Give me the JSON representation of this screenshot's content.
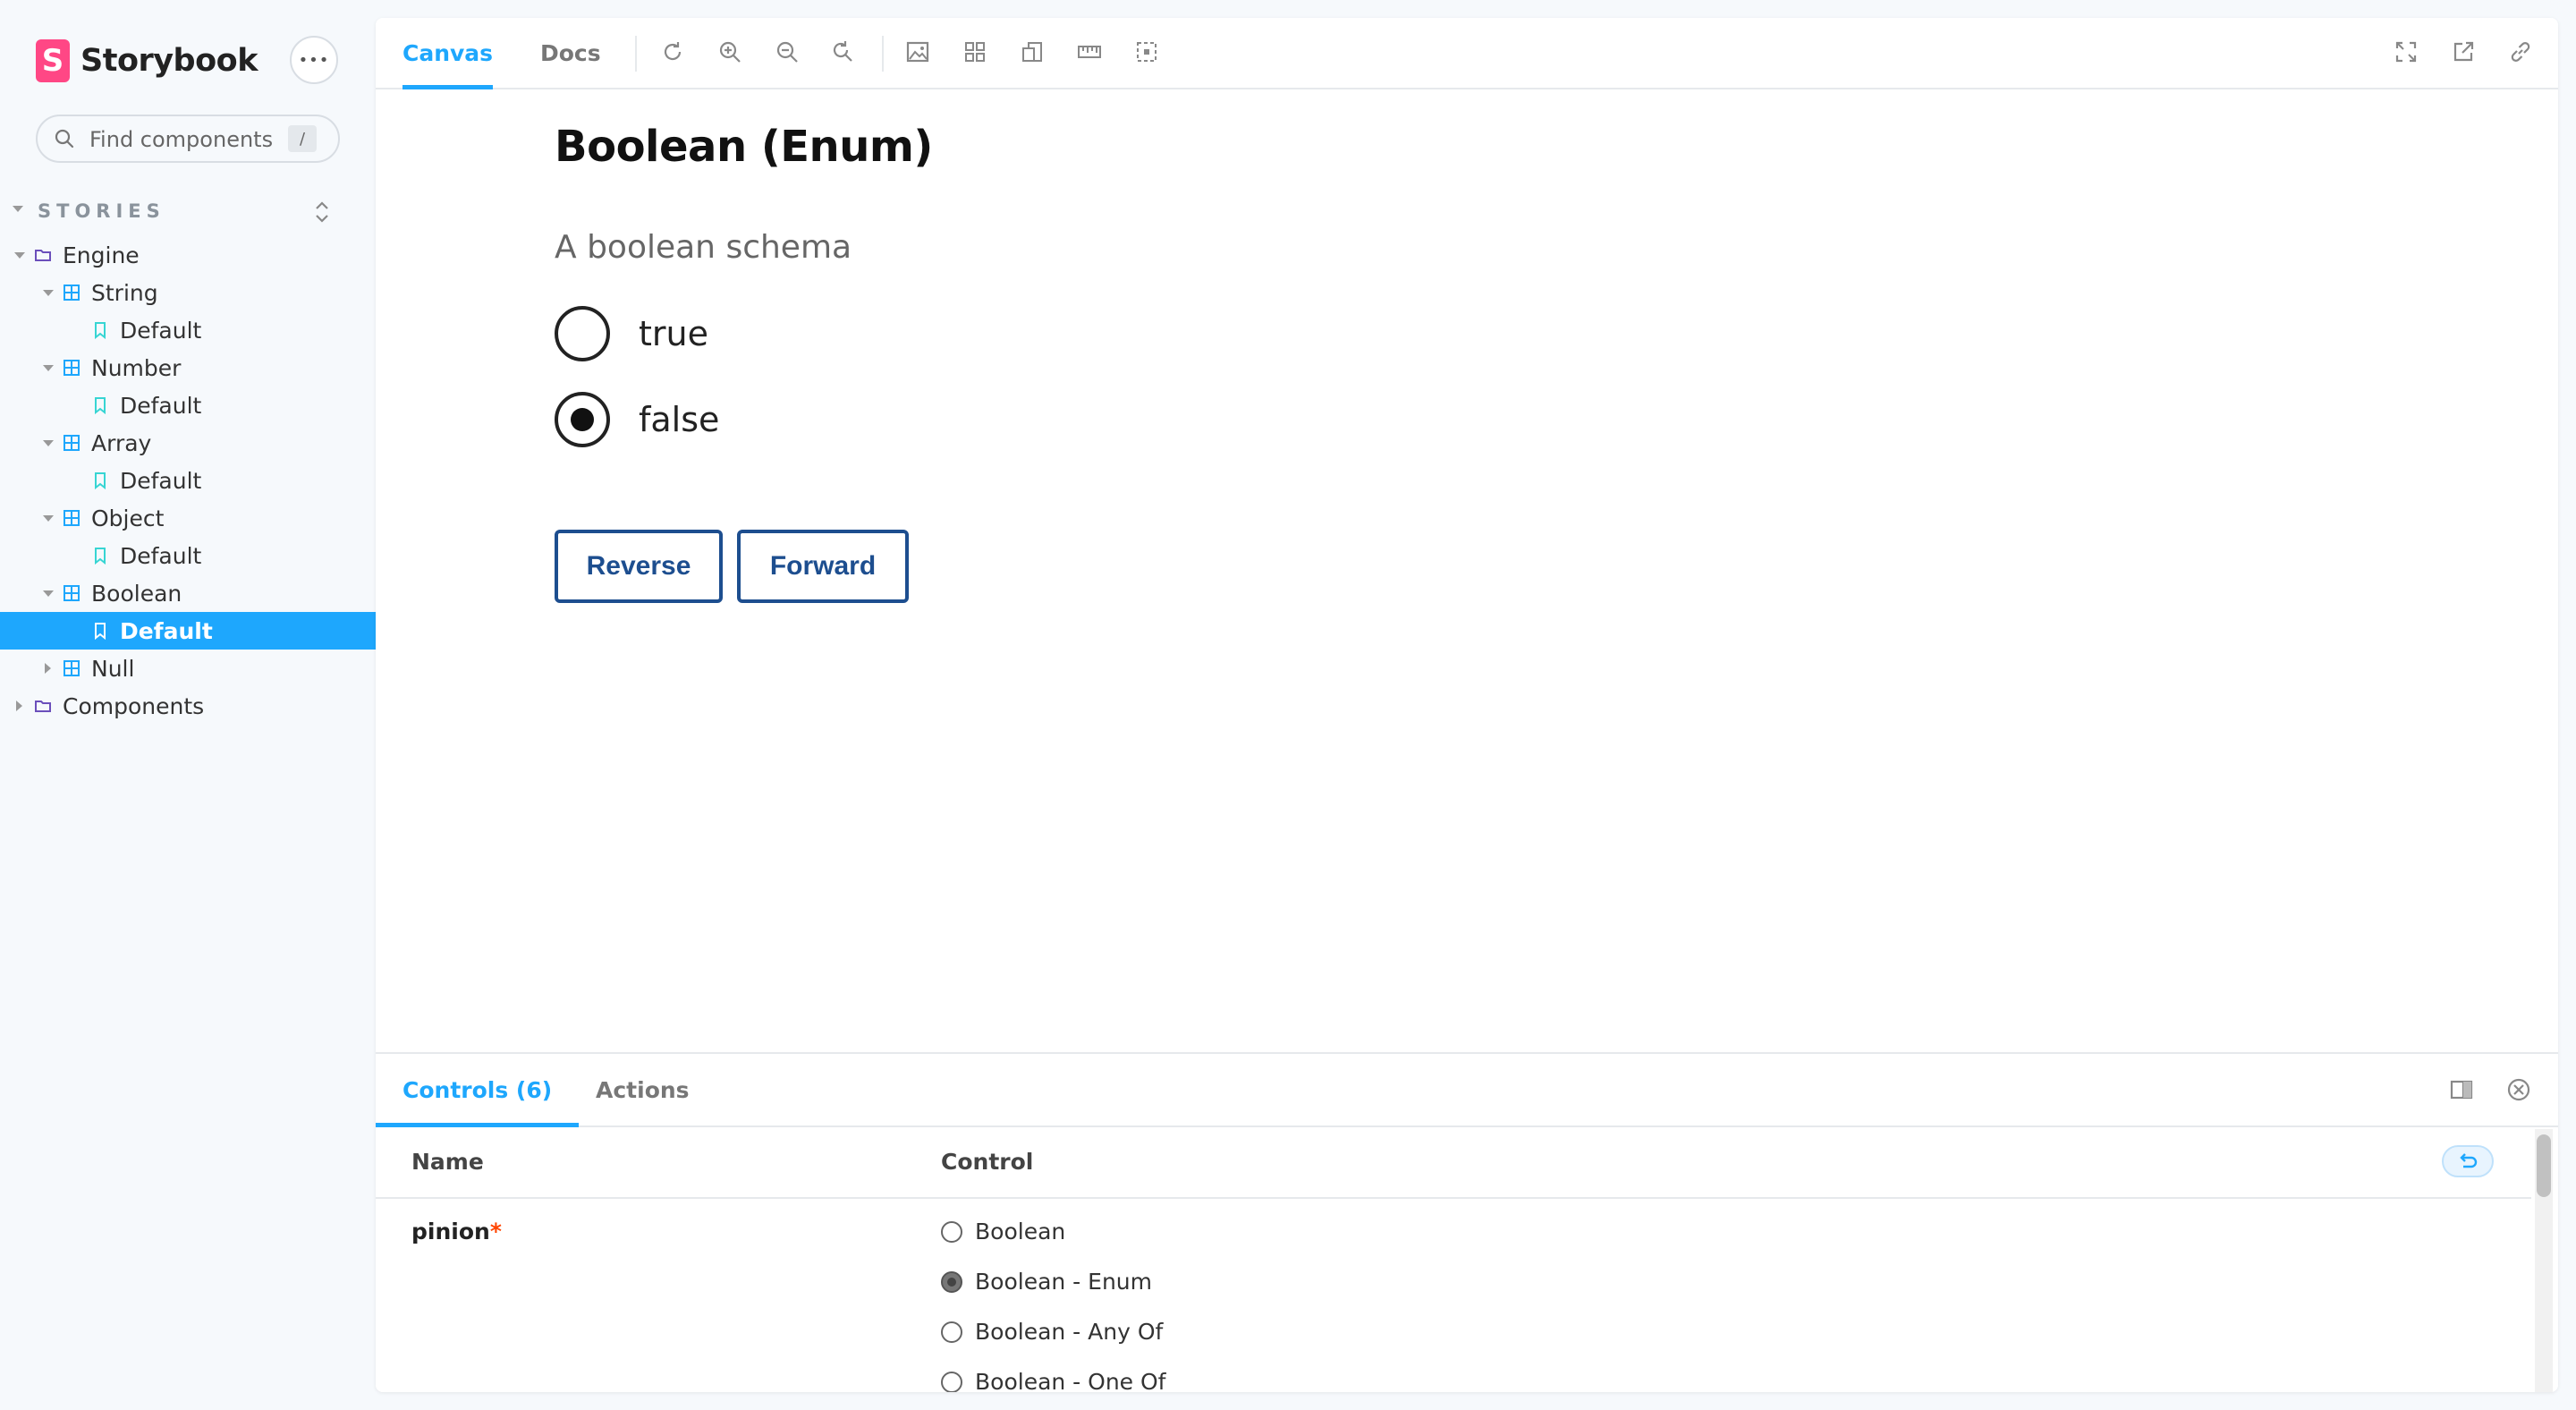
{
  "sidebar": {
    "brand": {
      "logo": "S",
      "name": "Storybook"
    },
    "more_button": "•••",
    "search": {
      "placeholder": "Find components",
      "shortcut": "/"
    },
    "section_title": "STORIES",
    "tree": [
      {
        "label": "Engine",
        "type": "folder",
        "expanded": true
      },
      {
        "label": "String",
        "type": "component",
        "expanded": true
      },
      {
        "label": "Default",
        "type": "story"
      },
      {
        "label": "Number",
        "type": "component",
        "expanded": true
      },
      {
        "label": "Default",
        "type": "story"
      },
      {
        "label": "Array",
        "type": "component",
        "expanded": true
      },
      {
        "label": "Default",
        "type": "story"
      },
      {
        "label": "Object",
        "type": "component",
        "expanded": true
      },
      {
        "label": "Default",
        "type": "story"
      },
      {
        "label": "Boolean",
        "type": "component",
        "expanded": true
      },
      {
        "label": "Default",
        "type": "story",
        "selected": true
      },
      {
        "label": "Null",
        "type": "component",
        "expanded": false
      },
      {
        "label": "Components",
        "type": "folder",
        "expanded": false
      }
    ]
  },
  "toolbar": {
    "tabs": [
      {
        "label": "Canvas",
        "active": true
      },
      {
        "label": "Docs",
        "active": false
      }
    ],
    "tools": [
      "reload-icon",
      "zoom-in-icon",
      "zoom-out-icon",
      "zoom-reset-icon",
      "background-icon",
      "grid-icon",
      "viewport-icon",
      "measure-icon",
      "outline-icon"
    ],
    "right_tools": [
      "fullscreen-icon",
      "open-new-tab-icon",
      "copy-link-icon"
    ]
  },
  "story": {
    "title": "Boolean (Enum)",
    "description": "A boolean schema",
    "options": [
      {
        "label": "true",
        "checked": false
      },
      {
        "label": "false",
        "checked": true
      }
    ],
    "buttons": {
      "reverse": "Reverse",
      "forward": "Forward"
    }
  },
  "addons": {
    "tabs": [
      {
        "label": "Controls (6)",
        "active": true
      },
      {
        "label": "Actions",
        "active": false
      }
    ],
    "columns": {
      "name": "Name",
      "control": "Control"
    },
    "row": {
      "name": "pinion",
      "required_mark": "*",
      "options": [
        {
          "label": "Boolean",
          "checked": false
        },
        {
          "label": "Boolean - Enum",
          "checked": true
        },
        {
          "label": "Boolean - Any Of",
          "checked": false
        },
        {
          "label": "Boolean - One Of",
          "checked": false
        }
      ]
    }
  },
  "colors": {
    "accent": "#1ea7fd",
    "brand": "#ff4785",
    "button": "#1d4e8f"
  }
}
